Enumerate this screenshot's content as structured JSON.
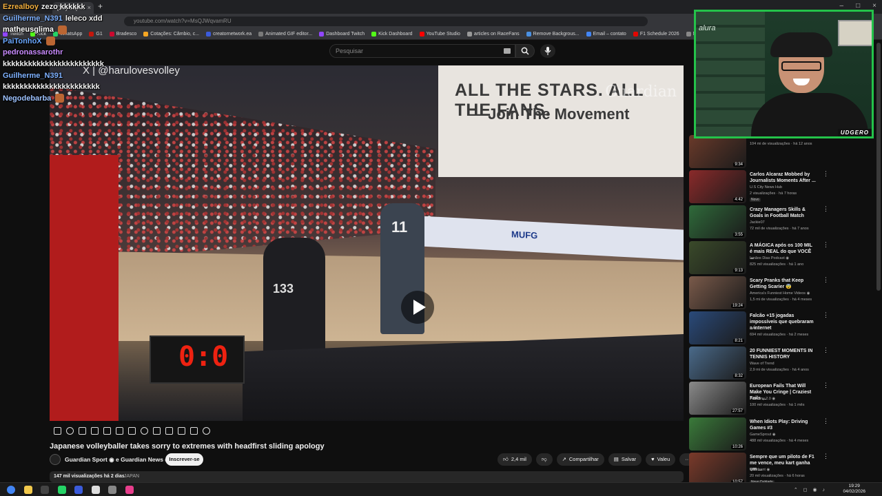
{
  "browser": {
    "tab_label": "(16) Jap...",
    "url_text": "youtube.com/watch?v=MsQJWqvamRU",
    "bookmarks": [
      {
        "label": "Twitch",
        "color": "#9146ff"
      },
      {
        "label": "Kick",
        "color": "#53fc18"
      },
      {
        "label": "WhatsApp",
        "color": "#25d366"
      },
      {
        "label": "G1",
        "color": "#c4170c"
      },
      {
        "label": "Bradesco",
        "color": "#cc092f"
      },
      {
        "label": "Cotações: Câmbio, c...",
        "color": "#f5a623"
      },
      {
        "label": "creatornetwork.ea",
        "color": "#3b5bdb"
      },
      {
        "label": "Animated GIF editor...",
        "color": "#7a7a7a"
      },
      {
        "label": "Dashboard Twitch",
        "color": "#9146ff"
      },
      {
        "label": "Kick Dashboard",
        "color": "#53fc18"
      },
      {
        "label": "YouTube Studio",
        "color": "#ff0000"
      },
      {
        "label": "articles on RaceFans",
        "color": "#999999"
      },
      {
        "label": "Remove Backgrous...",
        "color": "#4a90e2"
      },
      {
        "label": "Email – contato",
        "color": "#4285f4"
      },
      {
        "label": "F1 Schedule 2026",
        "color": "#e10600"
      },
      {
        "label": "Not...",
        "color": "#888888"
      }
    ]
  },
  "header": {
    "search_placeholder": "Pesquisar"
  },
  "video": {
    "watermark": "X | @harulovesvolley",
    "banner_line1": "ALL THE STARS. ALL THE FANS.",
    "banner_line2": "— Join The Movement",
    "banner_logo": "Guardian",
    "adboard_text": "MUFG",
    "player_number": "11",
    "camera_number": "133",
    "scoreboard": "0:0"
  },
  "info": {
    "title": "Japanese volleyballer takes sorry to extremes with headfirst sliding apology",
    "channel": "Guardian Sport ◉ e Guardian News ◉",
    "subscribe_label": "Inscrever-se",
    "like_count": "2,4 mil",
    "share_label": "Compartilhar",
    "save_label": "Salvar",
    "thanks_label": "Valeu",
    "views_date": "147 mil visualizações  há 2 dias",
    "tag": "JAPAN"
  },
  "recommendations": [
    {
      "title": "",
      "channel": "",
      "views": "104 mi de visualizações · há 12 anos",
      "duration": "9:34",
      "badge": "",
      "color": "#6a3a2a"
    },
    {
      "title": "Carlos Alcaraz Mobbed by Journalists Moments After ...",
      "channel": "U.S City News Hub",
      "views": "2 visualizações · há 7 horas",
      "duration": "4:42",
      "badge": "Novo",
      "color": "#8a2a2a"
    },
    {
      "title": "Crazy Managers Skills & Goals in Football Match",
      "channel": "Jackie07",
      "views": "72 mil de visualizações · há 7 anos",
      "duration": "3:55",
      "badge": "",
      "color": "#2f6a3a"
    },
    {
      "title": "A MÁGICA após os 100 MIL é mais REAL do que VOCÊ ...",
      "channel": "Irmãos Dias Podcast ◉",
      "views": "825 mil visualizações · há 1 ano",
      "duration": "9:13",
      "badge": "",
      "color": "#3a4a2a"
    },
    {
      "title": "Scary Pranks that Keep Getting Scarier 😨",
      "channel": "America's Funniest Home Videos ◉",
      "views": "1,5 mi de visualizações · há 4 meses",
      "duration": "19:24",
      "badge": "",
      "color": "#7a5a4a"
    },
    {
      "title": "Falcão +15 jogadas impossíveis que quebraram a internet",
      "channel": "BALL",
      "views": "694 mil visualizações · há 2 meses",
      "duration": "8:21",
      "badge": "",
      "color": "#2a4a7a"
    },
    {
      "title": "20 FUNNIEST MOMENTS IN TENNIS HISTORY",
      "channel": "Wave of Trend",
      "views": "2,9 mi de visualizações · há 4 anos",
      "duration": "8:32",
      "badge": "",
      "color": "#4a6a8a"
    },
    {
      "title": "European Fails That Will Make You Cringe | Craziest Fails ...",
      "channel": "FailArmy 2.0 ◉",
      "views": "100 mil visualizações · há 1 mês",
      "duration": "27:57",
      "badge": "",
      "color": "#8a8a8a"
    },
    {
      "title": "When Idiots Play: Driving Games #3",
      "channel": "GameSprout ◉",
      "views": "488 mil visualizações · há 4 meses",
      "duration": "10:26",
      "badge": "",
      "color": "#3a7a3a"
    },
    {
      "title": "Sempre que um piloto de F1 me vence, meu kart ganha um ...",
      "channel": "Quadrant ◉",
      "views": "20 mil visualizações · há 6 horas",
      "duration": "10:57",
      "badge": "Novo  Dublado",
      "color": "#7a3a2a"
    }
  ],
  "webcam": {
    "logo": "alura",
    "name": "UDGERO"
  },
  "chat": [
    {
      "user": "Ezrealboy",
      "text": "zezo kkkkkk",
      "user_color": "#f4b13f",
      "emote": false
    },
    {
      "user": "Guilherme_N391",
      "text": "leleco xdd",
      "user_color": "#7fb2ff",
      "emote": false
    },
    {
      "user": "matheusglima",
      "text": "",
      "user_color": "#ffffff",
      "emote": true
    },
    {
      "user": "PaiTonhoX",
      "text": "",
      "user_color": "#6aa7ff",
      "emote": true
    },
    {
      "user": "pedronassarothr",
      "text": "",
      "user_color": "#c98bff",
      "emote": false
    },
    {
      "user": "",
      "text": "kkkkkkkkkkkkkkkkkkkkkkkk",
      "user_color": "#ffffff",
      "emote": false
    },
    {
      "user": "Guilherme_N391",
      "text": "",
      "user_color": "#7fb2ff",
      "emote": false
    },
    {
      "user": "",
      "text": "kkkkkkkkkkkkkkkkkkkkkkk",
      "user_color": "#ffffff",
      "emote": false
    },
    {
      "user": "Negodebarba",
      "text": "",
      "user_color": "#9ec3ff",
      "emote": true
    }
  ],
  "taskbar": {
    "time": "19:29",
    "date": "04/02/2026",
    "icons": [
      {
        "name": "chrome-icon",
        "color": "#4285f4"
      },
      {
        "name": "folder-icon",
        "color": "#f2c94c"
      },
      {
        "name": "obs-icon",
        "color": "#444444"
      },
      {
        "name": "whatsapp-icon",
        "color": "#25d366"
      },
      {
        "name": "streamer-bot-icon",
        "color": "#3b5bdb"
      },
      {
        "name": "capcut-icon",
        "color": "#dddddd"
      },
      {
        "name": "settings-icon",
        "color": "#888888"
      },
      {
        "name": "app-icon",
        "color": "#e83e8c"
      }
    ]
  }
}
